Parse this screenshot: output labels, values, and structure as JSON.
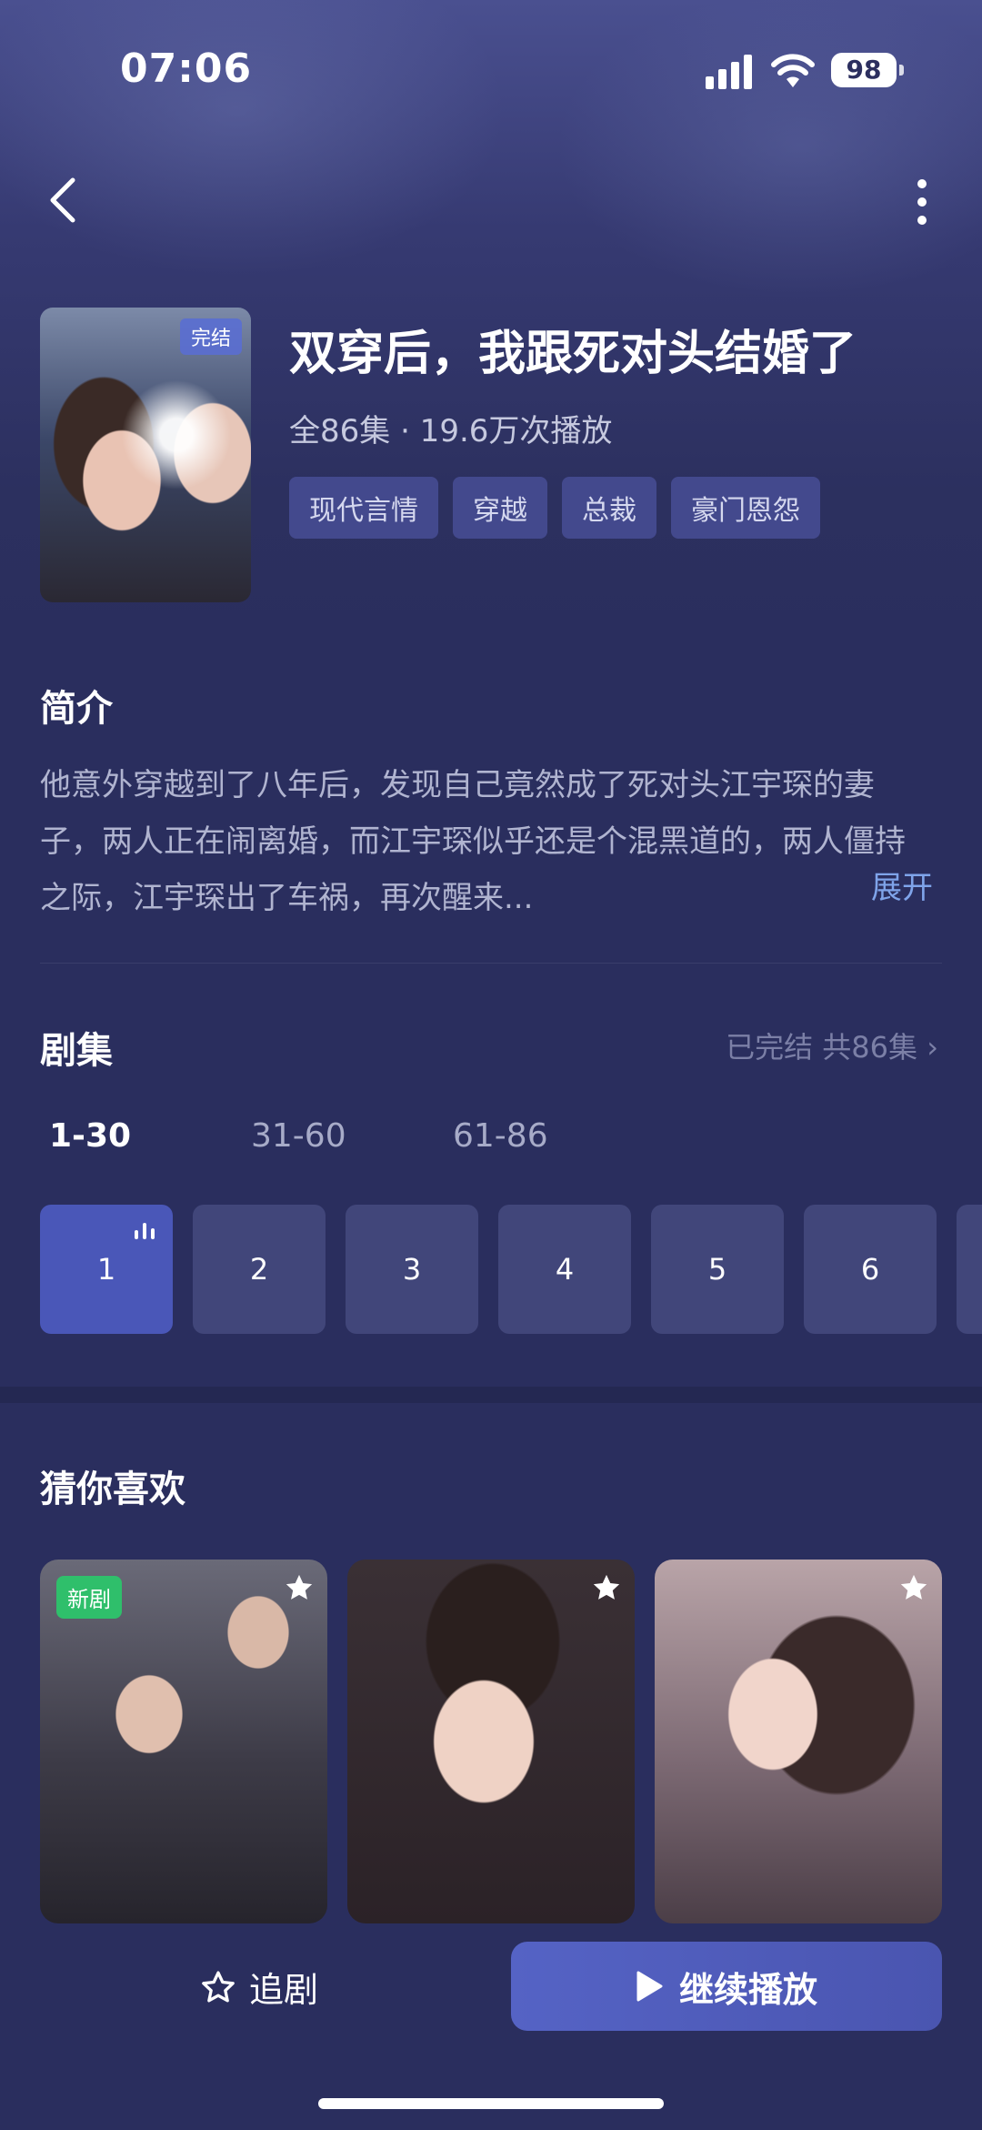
{
  "status_bar": {
    "time": "07:06",
    "battery": "98"
  },
  "drama": {
    "cover_badge": "完结",
    "title": "双穿后，我跟死对头结婚了",
    "meta": "全86集 · 19.6万次播放",
    "tags": [
      "现代言情",
      "穿越",
      "总裁",
      "豪门恩怨"
    ]
  },
  "intro": {
    "heading": "简介",
    "text": "他意外穿越到了八年后，发现自己竟然成了死对头江宇琛的妻子，两人正在闹离婚，而江宇琛似乎还是个混黑道的，两人僵持之际，江宇琛出了车祸，再次醒来...",
    "expand": "展开"
  },
  "episodes": {
    "heading": "剧集",
    "status": "已完结 共86集",
    "ranges": [
      "1-30",
      "31-60",
      "61-86"
    ],
    "items": [
      "1",
      "2",
      "3",
      "4",
      "5",
      "6"
    ]
  },
  "recommend": {
    "heading": "猜你喜欢",
    "items": [
      {
        "badge": "新剧"
      },
      {
        "badge": ""
      },
      {
        "badge": ""
      }
    ]
  },
  "actions": {
    "follow": "追剧",
    "play": "继续播放"
  },
  "colors": {
    "background": "#2a2e5e",
    "accent": "#4a57b8",
    "link": "#7fa4ea",
    "new_badge": "#2fbf6b"
  }
}
